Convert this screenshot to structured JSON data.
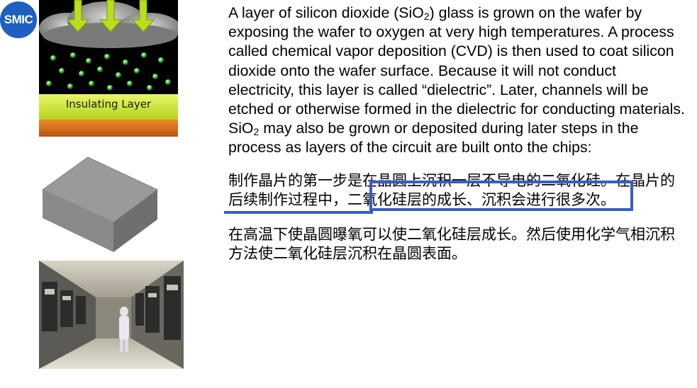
{
  "logo": {
    "text": "SMIC"
  },
  "illustration": {
    "label": "Insulating Layer"
  },
  "paragraph_en": {
    "part1": "A layer of silicon dioxide (SiO",
    "sub1": "2",
    "part2": ") glass is grown on the wafer by exposing the wafer to oxygen at very high temperatures. A process called chemical vapor deposition (CVD) is then used to coat silicon dioxide onto the wafer surface. Because it will not conduct electricity, this layer is called “dielectric”. Later, channels will be etched or otherwise formed in the dielectric for conducting materials. SiO",
    "sub2": "2",
    "part3": " may also be grown or deposited during later steps in the process as layers of the circuit are built onto the chips:"
  },
  "paragraph_cn1": "制作晶片的第一步是在晶圆上沉积一层不导电的二氧化硅。在晶片的后续制作过程中，二氧化硅层的成长、沉积会进行很多次。",
  "paragraph_cn2": "在高温下使晶圆曝氧可以使二氧化硅层成长。然后使用化学气相沉积方法使二氧化硅层沉积在晶圆表面。",
  "colors": {
    "logo": "#1f5fbf",
    "highlight": "#3a5cc8"
  },
  "icons": [
    "cvd-illustration",
    "wafer-block-image",
    "fab-cleanroom-photo"
  ]
}
